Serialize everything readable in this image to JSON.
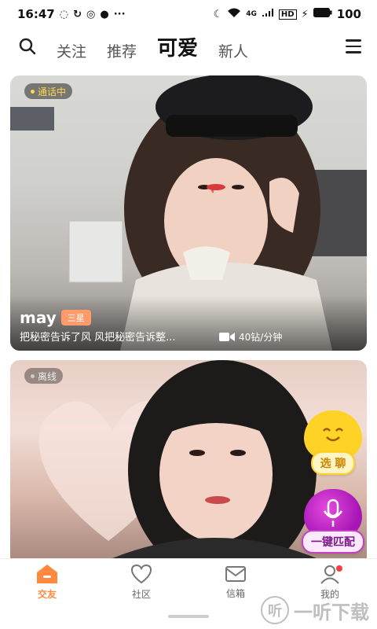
{
  "status_bar": {
    "time": "16:47",
    "battery": "100",
    "network": "4G",
    "hd": "HD"
  },
  "nav": {
    "tabs": [
      "关注",
      "推荐",
      "可爱",
      "新人"
    ],
    "active_tab": "可爱"
  },
  "cards": [
    {
      "status": "通话中",
      "status_color": "#ffd84a",
      "name": "may",
      "level": "三星",
      "signature": "把秘密告诉了风 风把秘密告诉整...",
      "price": "40钻/分钟"
    },
    {
      "status": "离线",
      "status_color": "#cccccc"
    }
  ],
  "floating": {
    "select_chat": "选 聊",
    "quick_match": "一键匹配"
  },
  "bottom_nav": {
    "items": [
      {
        "label": "交友",
        "icon": "home-icon"
      },
      {
        "label": "社区",
        "icon": "heart-icon"
      },
      {
        "label": "信箱",
        "icon": "mail-icon"
      },
      {
        "label": "我的",
        "icon": "profile-icon"
      }
    ],
    "active": "交友"
  },
  "watermark": {
    "text": "一听下载",
    "logo": "听"
  },
  "colors": {
    "accent": "#ff8a3d",
    "yellow": "#ffd326",
    "purple": "#a716b5"
  }
}
